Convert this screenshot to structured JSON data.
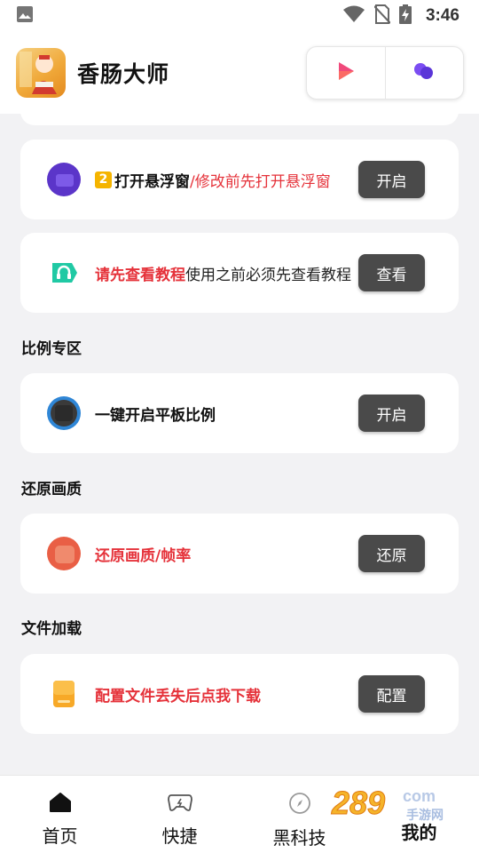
{
  "status_bar": {
    "time": "3:46"
  },
  "header": {
    "app_title": "香肠大师"
  },
  "cards": {
    "float_window": {
      "badge": "2",
      "title": "打开悬浮窗",
      "note": "/修改前先打开悬浮窗",
      "button": "开启"
    },
    "tutorial": {
      "title": "请先查看教程",
      "note": "使用之前必须先查看教程",
      "button": "查看"
    },
    "tablet_ratio": {
      "title": "一键开启平板比例",
      "button": "开启"
    },
    "restore_quality": {
      "title": "还原画质/帧率",
      "button": "还原"
    },
    "file_config": {
      "title": "配置文件丢失后点我下载",
      "button": "配置"
    }
  },
  "sections": {
    "ratio": "比例专区",
    "quality": "还原画质",
    "file": "文件加载"
  },
  "bottom_nav": {
    "items": [
      {
        "label": "首页",
        "icon": "home-icon"
      },
      {
        "label": "快捷",
        "icon": "gamepad-icon"
      },
      {
        "label": "黑科技",
        "icon": "compass-icon"
      },
      {
        "label": "我的",
        "icon": "profile-icon"
      }
    ],
    "active": "我的"
  },
  "watermark": {
    "digits": "289",
    "suffix": "com",
    "site": "手游网"
  },
  "colors": {
    "accent_red": "#e5323a",
    "button_bg": "#4a4a4a",
    "page_bg": "#f2f2f4"
  }
}
